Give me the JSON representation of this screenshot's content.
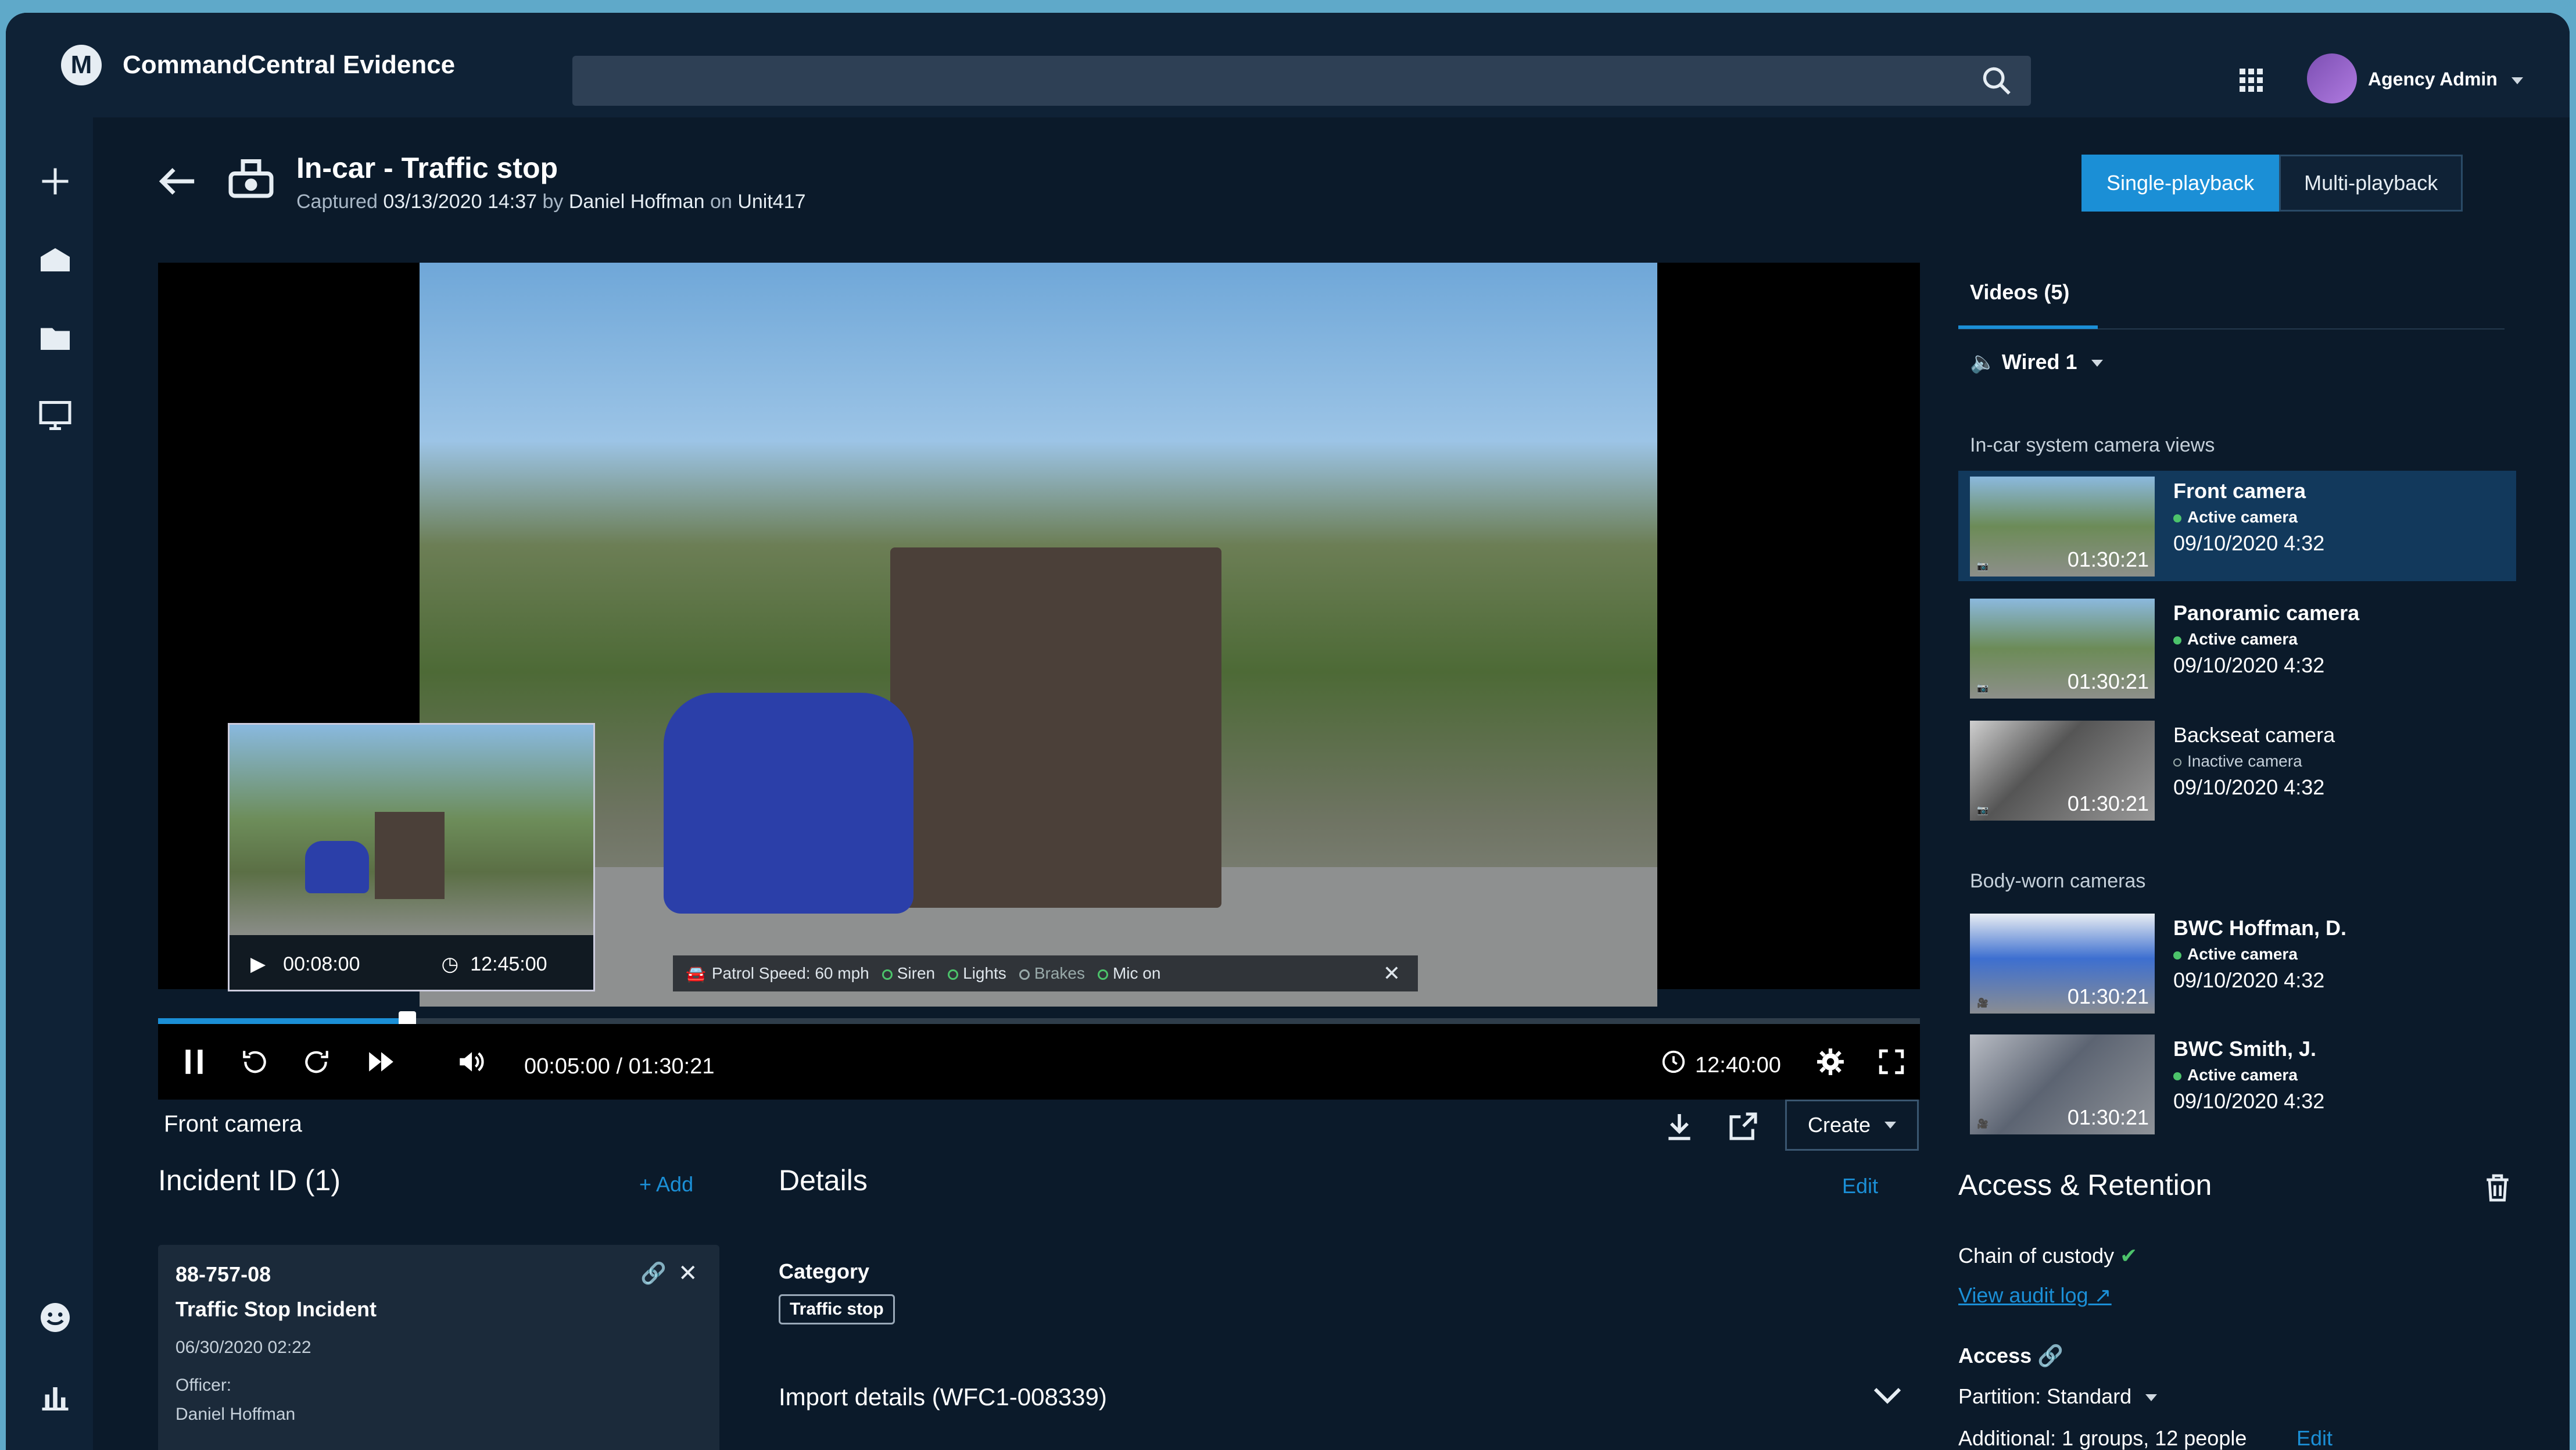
{
  "app": {
    "title": "CommandCentral Evidence",
    "user": "Agency Admin"
  },
  "header": {
    "title": "In-car - Traffic stop",
    "captured_prefix": "Captured",
    "captured_date": "03/13/2020 14:37",
    "by": "by",
    "author": "Daniel Hoffman",
    "on": "on",
    "unit": "Unit417",
    "single_playback": "Single-playback",
    "multi_playback": "Multi-playback"
  },
  "player": {
    "pip_time": "00:08:00",
    "pip_clock": "12:45:00",
    "telemetry": {
      "speed": "Patrol Speed: 60 mph",
      "siren": "Siren",
      "lights": "Lights",
      "brakes": "Brakes",
      "mic": "Mic on"
    },
    "current_time": "00:05:00 / 01:30:21",
    "clock": "12:40:00",
    "progress": 0.14,
    "camera_label": "Front camera",
    "create_label": "Create"
  },
  "videos": {
    "tab_label": "Videos (5)",
    "audio_source": "Wired 1",
    "incar_section": "In-car system camera views",
    "bodyworn_section": "Body-worn cameras",
    "incar": [
      {
        "name": "Front camera",
        "status": "Active camera",
        "date": "09/10/2020 4:32",
        "duration": "01:30:21"
      },
      {
        "name": "Panoramic camera",
        "status": "Active camera",
        "date": "09/10/2020 4:32",
        "duration": "01:30:21"
      },
      {
        "name": "Backseat camera",
        "status": "Inactive camera",
        "date": "09/10/2020 4:32",
        "duration": "01:30:21"
      }
    ],
    "bodyworn": [
      {
        "name": "BWC Hoffman, D.",
        "status": "Active camera",
        "date": "09/10/2020 4:32",
        "duration": "01:30:21"
      },
      {
        "name": "BWC Smith, J.",
        "status": "Active camera",
        "date": "09/10/2020 4:32",
        "duration": "01:30:21"
      }
    ]
  },
  "incident": {
    "title": "Incident ID (1)",
    "add": "+ Add",
    "id": "88-757-08",
    "name": "Traffic Stop Incident",
    "date": "06/30/2020 02:22",
    "officer_label": "Officer:",
    "officer": "Daniel Hoffman"
  },
  "details": {
    "title": "Details",
    "edit": "Edit",
    "category_label": "Category",
    "category": "Traffic stop",
    "import": "Import details (WFC1-008339)"
  },
  "access": {
    "title": "Access & Retention",
    "chain": "Chain of custody",
    "audit": "View audit log",
    "access_label": "Access",
    "partition_label": "Partition:",
    "partition": "Standard",
    "additional": "Additional: 1 groups, 12 people",
    "edit": "Edit"
  }
}
